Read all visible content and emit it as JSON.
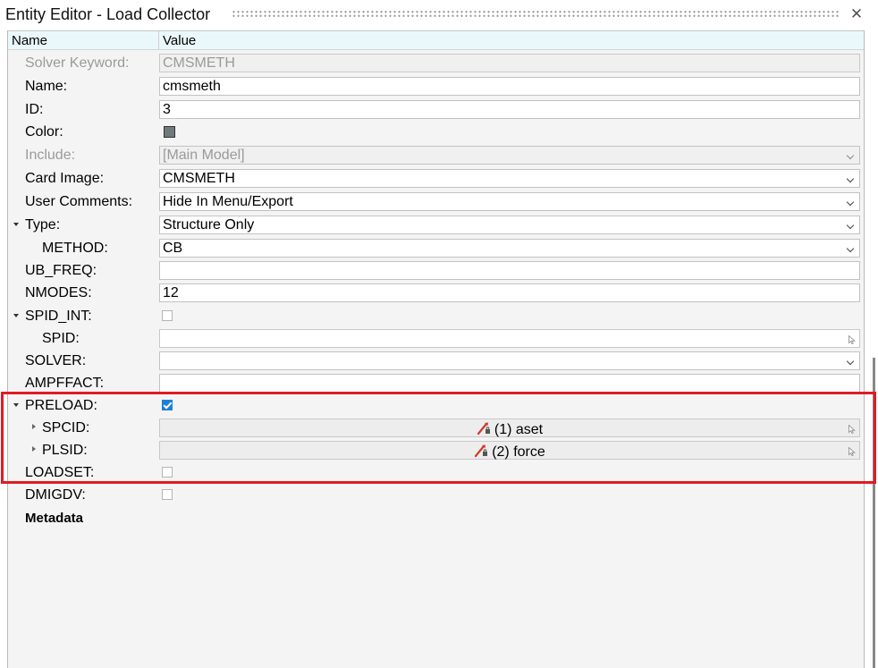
{
  "window": {
    "title": "Entity Editor - Load Collector",
    "close_label": "✕"
  },
  "header": {
    "name": "Name",
    "value": "Value"
  },
  "rows": {
    "solver_keyword": {
      "label": "Solver Keyword:",
      "value": "CMSMETH"
    },
    "name": {
      "label": "Name:",
      "value": "cmsmeth"
    },
    "id": {
      "label": "ID:",
      "value": "3"
    },
    "color": {
      "label": "Color:",
      "swatch": "#6f7a7c"
    },
    "include": {
      "label": "Include:",
      "value": "[Main Model]"
    },
    "card_image": {
      "label": "Card Image:",
      "value": "CMSMETH"
    },
    "user_comments": {
      "label": "User Comments:",
      "value": "Hide In Menu/Export"
    },
    "type": {
      "label": "Type:",
      "value": "Structure Only"
    },
    "method": {
      "label": "METHOD:",
      "value": "CB"
    },
    "ub_freq": {
      "label": "UB_FREQ:",
      "value": ""
    },
    "nmodes": {
      "label": "NMODES:",
      "value": "12"
    },
    "spid_int": {
      "label": "SPID_INT:",
      "checked": false
    },
    "spid": {
      "label": "SPID:",
      "value": ""
    },
    "solver": {
      "label": "SOLVER:",
      "value": ""
    },
    "ampffact": {
      "label": "AMPFFACT:",
      "value": ""
    },
    "preload": {
      "label": "PRELOAD:",
      "checked": true
    },
    "spcid": {
      "label": "SPCID:",
      "value": "(1) aset"
    },
    "plsid": {
      "label": "PLSID:",
      "value": "(2) force"
    },
    "loadset": {
      "label": "LOADSET:",
      "checked": false
    },
    "dmigdv": {
      "label": "DMIGDV:",
      "checked": false
    },
    "metadata": {
      "label": "Metadata"
    }
  },
  "colors": {
    "highlight": "#e01b24",
    "header_bg": "#eaf8fb",
    "checkbox_on": "#1e7fd6"
  }
}
